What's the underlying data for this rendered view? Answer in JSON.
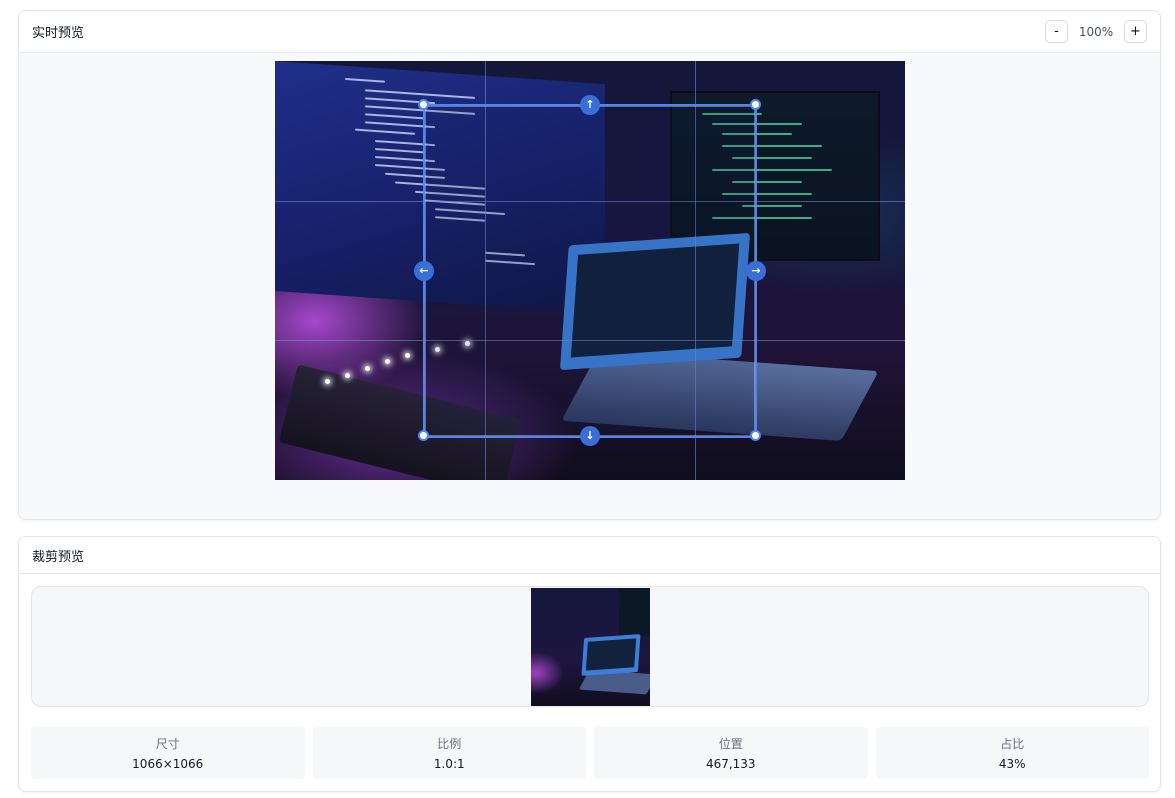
{
  "live_panel": {
    "title": "实时预览",
    "zoom_out_label": "-",
    "zoom_value": "100%",
    "zoom_in_label": "+"
  },
  "crop_handles": {
    "top_icon": "arrow-up-icon",
    "bottom_icon": "arrow-down-icon",
    "left_icon": "arrow-left-icon",
    "right_icon": "arrow-right-icon",
    "top_glyph": "↑",
    "bottom_glyph": "↓",
    "left_glyph": "←",
    "right_glyph": "→"
  },
  "crop_panel": {
    "title": "裁剪预览",
    "stats": [
      {
        "label": "尺寸",
        "value": "1066×1066"
      },
      {
        "label": "比例",
        "value": "1.0:1"
      },
      {
        "label": "位置",
        "value": "467,133"
      },
      {
        "label": "占比",
        "value": "43%"
      }
    ]
  },
  "colors": {
    "accent": "#4f86f7",
    "handle": "#3b6fd8"
  }
}
